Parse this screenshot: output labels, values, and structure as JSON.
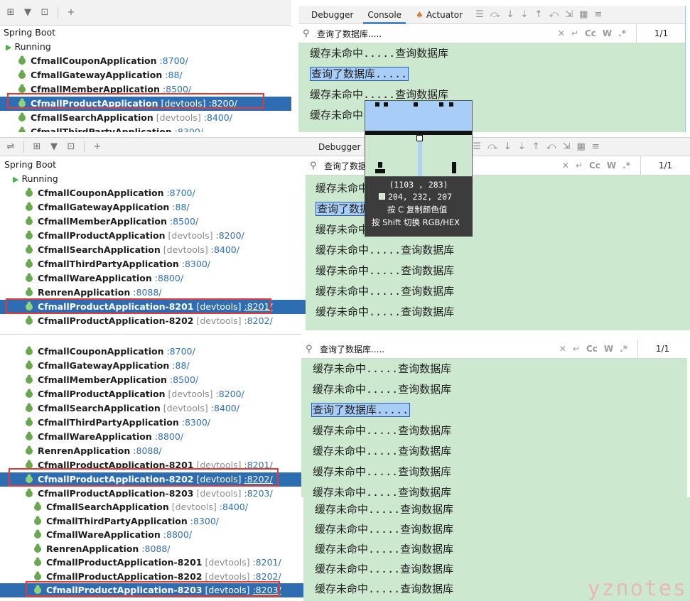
{
  "tabs": {
    "debugger": "Debugger",
    "console": "Console",
    "actuator": "Actuator"
  },
  "search": {
    "query": "查询了数据库.....",
    "query_short": "查询了数据",
    "count": "1/1",
    "cc": "Cc",
    "w": "W",
    "star": ".*"
  },
  "tree": {
    "root": "Spring Boot",
    "running": "Running",
    "apps": [
      {
        "name": "CfmallCouponApplication",
        "tag": "",
        "port": ":8700/"
      },
      {
        "name": "CfmallGatewayApplication",
        "tag": "",
        "port": ":88/"
      },
      {
        "name": "CfmallMemberApplication",
        "tag": "",
        "port": ":8500/"
      },
      {
        "name": "CfmallProductApplication",
        "tag": "[devtools]",
        "port": ":8200/"
      },
      {
        "name": "CfmallSearchApplication",
        "tag": "[devtools]",
        "port": ":8400/"
      },
      {
        "name": "CfmallThirdPartyApplication",
        "tag": "",
        "port": ":8300/"
      },
      {
        "name": "CfmallWareApplication",
        "tag": "",
        "port": ":8800/"
      },
      {
        "name": "RenrenApplication",
        "tag": "",
        "port": ":8088/"
      },
      {
        "name": "CfmallProductApplication-8201",
        "tag": "[devtools]",
        "port": ":8201/"
      },
      {
        "name": "CfmallProductApplication-8202",
        "tag": "[devtools]",
        "port": ":8202/"
      },
      {
        "name": "CfmallProductApplication-8203",
        "tag": "[devtools]",
        "port": ":8203/"
      }
    ]
  },
  "console": {
    "miss": "缓存未命中.....查询数据库",
    "hit": "查询了数据库.....",
    "miss_short": "缓存未命中"
  },
  "picker": {
    "coords": "(1103 , 283)",
    "rgb": "204, 232, 207",
    "hint_copy": "按 C 复制颜色值",
    "hint_switch": "按 Shift 切换 RGB/HEX"
  },
  "watermark": "yznotes",
  "colors": {
    "console_bg": "#cce8cf",
    "selection": "#2f6db3",
    "highlight": "#a8cdf7",
    "red_box": "#e53935"
  }
}
